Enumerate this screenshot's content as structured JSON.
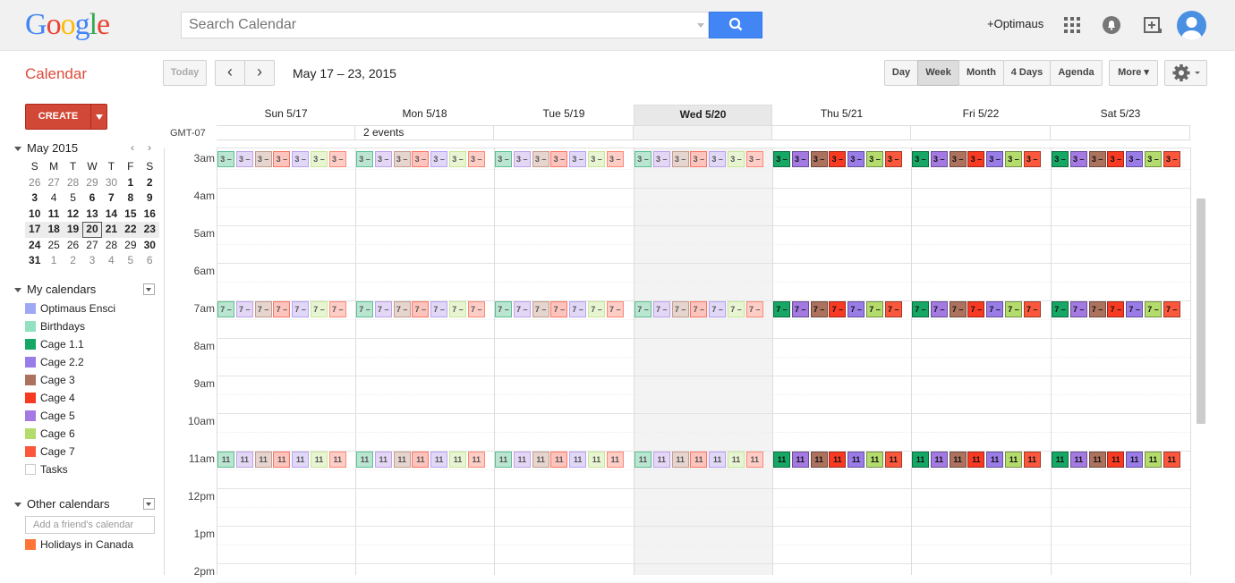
{
  "app": {
    "logo": "Google",
    "title": "Calendar",
    "search_placeholder": "Search Calendar",
    "user": "+Optimaus"
  },
  "toolbar": {
    "today": "Today",
    "prev": "‹",
    "next": "›",
    "date_range": "May 17 – 23, 2015",
    "views": [
      "Day",
      "Week",
      "Month",
      "4 Days",
      "Agenda"
    ],
    "active_view": "Week",
    "more": "More ▾"
  },
  "sidebar": {
    "create": "CREATE",
    "mini_month": "May 2015",
    "mini_prev": "‹",
    "mini_next": "›",
    "weekdays": [
      "S",
      "M",
      "T",
      "W",
      "T",
      "F",
      "S"
    ],
    "weeks": [
      [
        "26",
        "27",
        "28",
        "29",
        "30",
        "1",
        "2"
      ],
      [
        "3",
        "4",
        "5",
        "6",
        "7",
        "8",
        "9"
      ],
      [
        "10",
        "11",
        "12",
        "13",
        "14",
        "15",
        "16"
      ],
      [
        "17",
        "18",
        "19",
        "20",
        "21",
        "22",
        "23"
      ],
      [
        "24",
        "25",
        "26",
        "27",
        "28",
        "29",
        "30"
      ],
      [
        "31",
        "1",
        "2",
        "3",
        "4",
        "5",
        "6"
      ]
    ],
    "my_calendars_label": "My calendars",
    "my_calendars": [
      {
        "name": "Optimaus Ensci",
        "color": "#9fa8f5"
      },
      {
        "name": "Birthdays",
        "color": "#92e1c0"
      },
      {
        "name": "Cage 1.1",
        "color": "#16a765"
      },
      {
        "name": "Cage 2.2",
        "color": "#9a7ce9"
      },
      {
        "name": "Cage 3",
        "color": "#ac725e"
      },
      {
        "name": "Cage 4",
        "color": "#f83a22"
      },
      {
        "name": "Cage 5",
        "color": "#a47ae2"
      },
      {
        "name": "Cage 6",
        "color": "#b3dc6c"
      },
      {
        "name": "Cage 7",
        "color": "#fa573c"
      },
      {
        "name": "Tasks",
        "color": "#ffffff"
      }
    ],
    "other_calendars_label": "Other calendars",
    "friend_placeholder": "Add a friend's calendar",
    "other_calendars": [
      {
        "name": "Holidays in Canada",
        "color": "#ff7537"
      }
    ]
  },
  "calendar": {
    "timezone": "GMT-07",
    "days": [
      "Sun 5/17",
      "Mon 5/18",
      "Tue 5/19",
      "Wed 5/20",
      "Thu 5/21",
      "Fri 5/22",
      "Sat 5/23"
    ],
    "current_day": "Wed 5/20",
    "all_day_note": "2 events",
    "hours": [
      "3am",
      "4am",
      "5am",
      "6am",
      "7am",
      "8am",
      "9am",
      "10am",
      "11am",
      "12pm",
      "1pm",
      "2pm"
    ],
    "event_slots": [
      {
        "hour": "3am",
        "label": "3 –"
      },
      {
        "hour": "7am",
        "label": "7 –"
      },
      {
        "hour": "11am",
        "label": "11"
      }
    ],
    "event_colors": [
      "#16a765",
      "#a47ae2",
      "#ac725e",
      "#f83a22",
      "#9a7ce9",
      "#b3dc6c",
      "#fa573c"
    ],
    "faded_days": [
      "Sun 5/17",
      "Mon 5/18",
      "Tue 5/19",
      "Wed 5/20"
    ]
  }
}
